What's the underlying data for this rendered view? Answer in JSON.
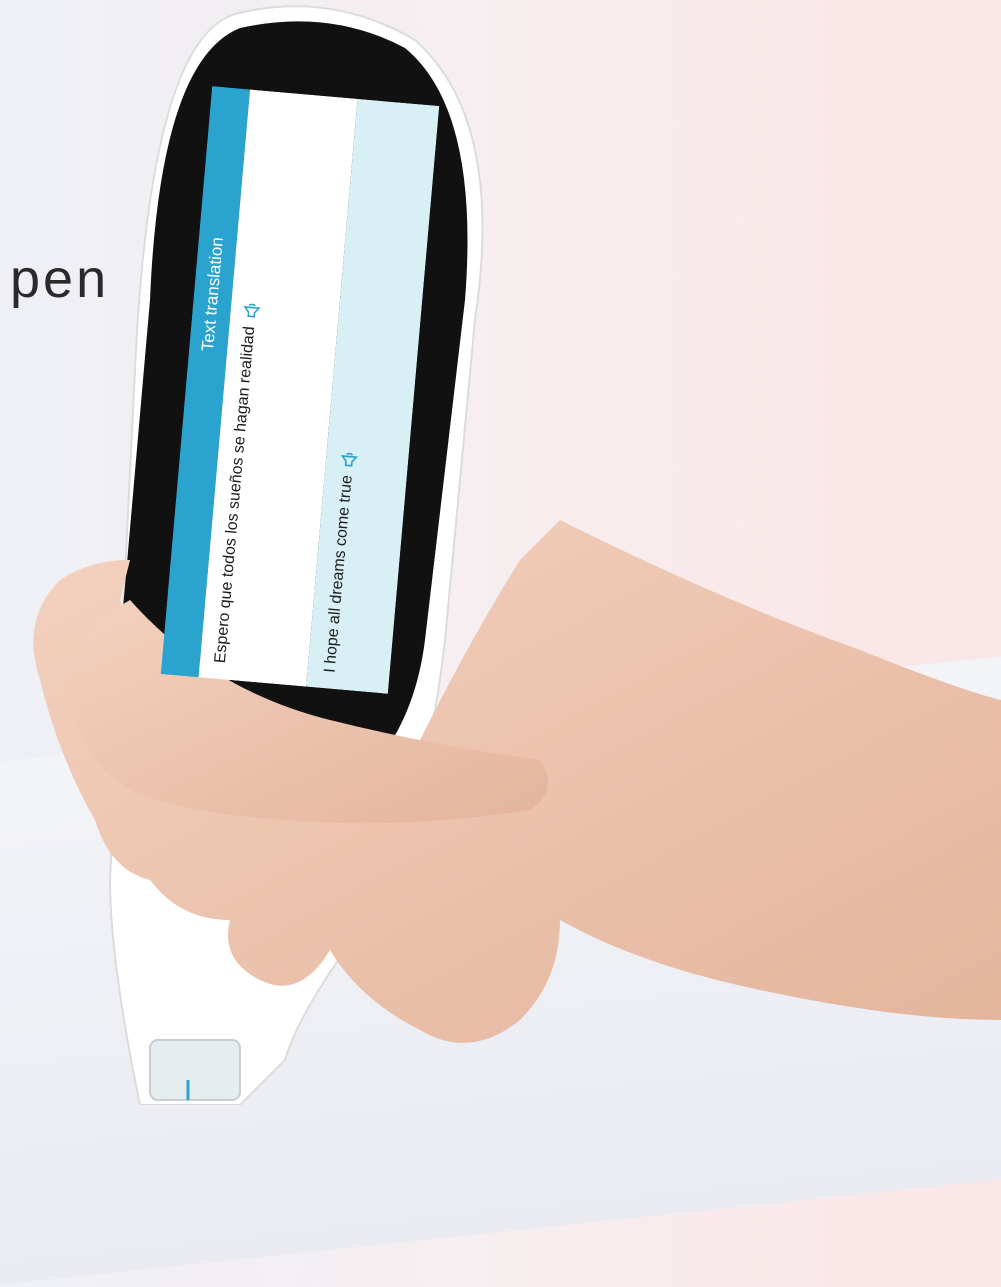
{
  "headline": "pen",
  "device_screen": {
    "title": "Text translation",
    "source_text": "Espero que todos los sueños se hagan realidad",
    "translated_text": "I hope all dreams come true",
    "icons": [
      "speaker-icon",
      "speaker-icon"
    ]
  },
  "colors": {
    "screen_header": "#2aa3cf",
    "translation_band": "#d7eff5",
    "pen_body": "#ffffff",
    "pen_bezel": "#111111"
  }
}
